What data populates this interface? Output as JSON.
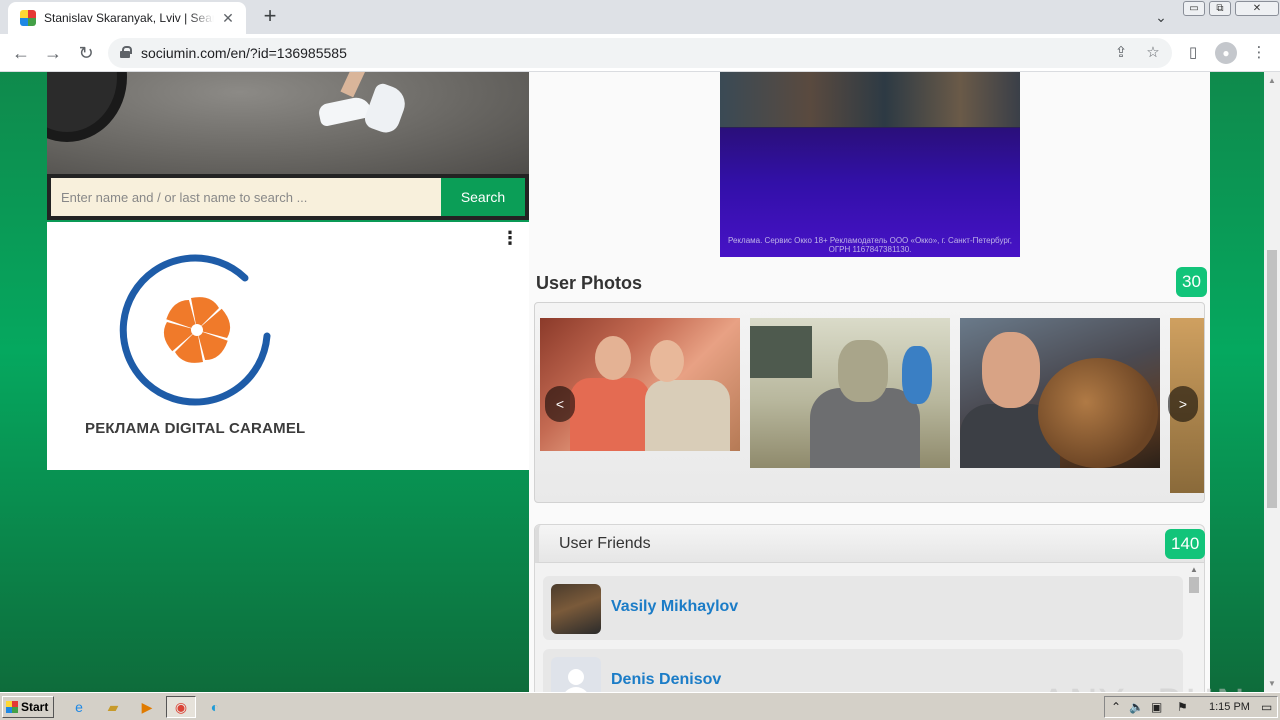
{
  "browser": {
    "tab_title": "Stanislav Skaranyak, Lviv | Search In",
    "tab_close": "✕",
    "new_tab": "+",
    "url": "sociumin.com/en/?id=136985585",
    "window_min": "▭",
    "window_restore": "⧉",
    "window_close": "✕"
  },
  "search": {
    "placeholder": "Enter name and / or last name to search ...",
    "button": "Search"
  },
  "ad": {
    "more": "⋮",
    "brand": "РЕКЛАМА DIGITAL CARAMEL"
  },
  "video_ad": {
    "disclaimer": "Реклама. Сервис Окко 18+ Рекламодатель ООО «Окко», г. Санкт-Петербург, ОГРН 1167847381130."
  },
  "photos": {
    "title": "User Photos",
    "count": "30",
    "prev": "<",
    "next": ">"
  },
  "friends": {
    "title": "User Friends",
    "count": "140",
    "items": [
      {
        "name": "Vasily Mikhaylov"
      },
      {
        "name": "Denis Denisov"
      }
    ]
  },
  "watermark": "ANY▷RUN",
  "taskbar": {
    "start": "Start",
    "clock": "1:15 PM"
  },
  "colors": {
    "accent_green": "#0b9e57",
    "badge_green": "#12c47a",
    "link_blue": "#1b7cc7",
    "brand_blue": "#1e5ca8",
    "brand_orange": "#f07a2a"
  }
}
